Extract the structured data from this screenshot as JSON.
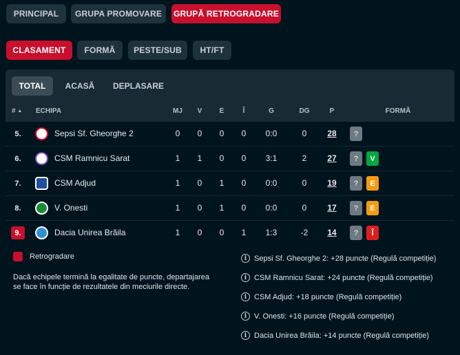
{
  "top_tabs": [
    {
      "label": "PRINCIPAL",
      "active": false
    },
    {
      "label": "GRUPA PROMOVARE",
      "active": false
    },
    {
      "label": "GRUPĂ RETROGRADARE",
      "active": true
    }
  ],
  "sub_tabs": [
    {
      "label": "CLASAMENT",
      "active": true
    },
    {
      "label": "FORMĂ",
      "active": false
    },
    {
      "label": "PESTE/SUB",
      "active": false
    },
    {
      "label": "HT/FT",
      "active": false
    }
  ],
  "venue_tabs": [
    {
      "label": "TOTAL",
      "active": true
    },
    {
      "label": "ACASĂ",
      "active": false
    },
    {
      "label": "DEPLASARE",
      "active": false
    }
  ],
  "table": {
    "headers": {
      "rank": "#",
      "sort_icon": "▲",
      "team": "ECHIPA",
      "mj": "MJ",
      "v": "V",
      "e": "E",
      "i": "Î",
      "g": "G",
      "dg": "DG",
      "p": "P",
      "forma": "FORMĂ"
    },
    "rows": [
      {
        "rank": "5.",
        "team": "Sepsi Sf. Gheorghe 2",
        "mj": "0",
        "v": "0",
        "e": "0",
        "i": "0",
        "g": "0:0",
        "dg": "0",
        "p": "28",
        "form": [
          {
            "t": "?",
            "k": "q"
          }
        ],
        "relegation": false,
        "logo_icon": "sepsi-crest-icon"
      },
      {
        "rank": "6.",
        "team": "CSM Ramnicu Sarat",
        "mj": "1",
        "v": "1",
        "e": "0",
        "i": "0",
        "g": "3:1",
        "dg": "2",
        "p": "27",
        "form": [
          {
            "t": "?",
            "k": "q"
          },
          {
            "t": "V",
            "k": "w"
          }
        ],
        "relegation": false,
        "logo_icon": "csm-ramnicu-crest-icon"
      },
      {
        "rank": "7.",
        "team": "CSM Adjud",
        "mj": "1",
        "v": "0",
        "e": "1",
        "i": "0",
        "g": "0:0",
        "dg": "0",
        "p": "19",
        "form": [
          {
            "t": "?",
            "k": "q"
          },
          {
            "t": "E",
            "k": "d"
          }
        ],
        "relegation": false,
        "logo_icon": "csm-adjud-crest-icon"
      },
      {
        "rank": "8.",
        "team": "V. Onesti",
        "mj": "1",
        "v": "0",
        "e": "1",
        "i": "0",
        "g": "0:0",
        "dg": "0",
        "p": "17",
        "form": [
          {
            "t": "?",
            "k": "q"
          },
          {
            "t": "E",
            "k": "d"
          }
        ],
        "relegation": false,
        "logo_icon": "onesti-crest-icon"
      },
      {
        "rank": "9.",
        "team": "Dacia Unirea Brăila",
        "mj": "1",
        "v": "0",
        "e": "0",
        "i": "1",
        "g": "1:3",
        "dg": "-2",
        "p": "14",
        "form": [
          {
            "t": "?",
            "k": "q"
          },
          {
            "t": "Î",
            "k": "l"
          }
        ],
        "relegation": true,
        "logo_icon": "dacia-crest-icon"
      }
    ]
  },
  "legend": {
    "relegation_label": "Retrogradare",
    "relegation_color": "#c8102e",
    "tiebreak_line1": "Dacă echipele termină la egalitate de puncte, departajarea",
    "tiebreak_line2": "se face în funcție de rezultatele din meciurile directe."
  },
  "notes": [
    "Sepsi Sf. Gheorghe 2: +28 puncte (Regulă competiție)",
    "CSM Ramnicu Sarat: +24 puncte (Regulă competiție)",
    "CSM Adjud: +18 puncte (Regulă competiție)",
    "V. Onesti: +16 puncte (Regulă competiție)",
    "Dacia Unirea Brăila: +14 puncte (Regulă competiție)"
  ],
  "colors": {
    "accent": "#c8102e",
    "win": "#00a83f",
    "draw": "#f39c12",
    "loss": "#dc1e1e",
    "background": "#00141e"
  }
}
